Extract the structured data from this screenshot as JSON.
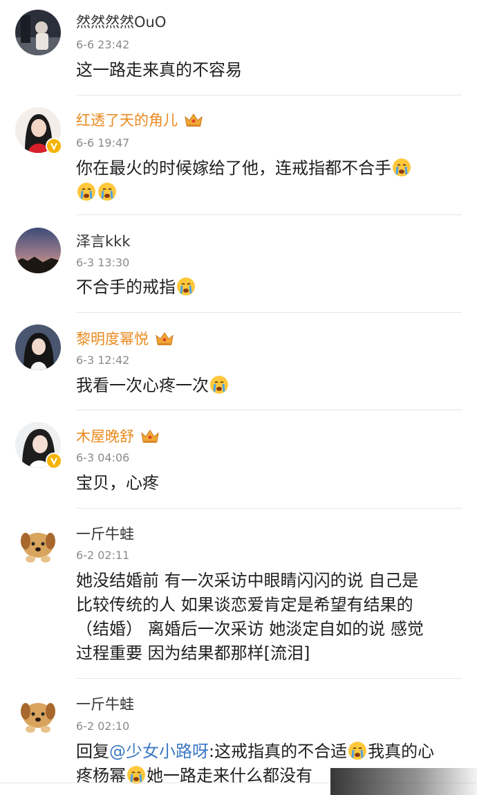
{
  "comments": [
    {
      "name": "然然然然OuO",
      "time": "6-6 23:42",
      "text": "这一路走来真的不容易"
    },
    {
      "name": "红透了天的角儿",
      "time": "6-6 19:47",
      "text_a": "你在最火的时候嫁给了他，连戒指都不合手"
    },
    {
      "name": "泽言kkk",
      "time": "6-3 13:30",
      "text_a": "不合手的戒指"
    },
    {
      "name": "黎明度幂悦",
      "time": "6-3 12:42",
      "text_a": "我看一次心疼一次"
    },
    {
      "name": "木屋晚舒",
      "time": "6-3 04:06",
      "text": "宝贝，心疼"
    },
    {
      "name": "一斤牛蛙",
      "time": "6-2 02:11",
      "lines": [
        "她没结婚前 有一次采访中眼睛闪闪的说 自己是",
        "比较传统的人 如果谈恋爱肯定是希望有结果的",
        "（结婚） 离婚后一次采访 她淡定自如的说 感觉",
        "过程重要 因为结果都那样[流泪]"
      ]
    },
    {
      "name": "一斤牛蛙",
      "time": "6-2 02:10",
      "reply_prefix": "回复",
      "mention": "@少女小路呀",
      "text_a": ":这戒指真的不合适",
      "text_b": "我真的心",
      "text_c": "疼杨幂",
      "text_d": "她一路走来什么都没有"
    }
  ],
  "colors": {
    "vip_name": "#e98a1e",
    "mention": "#3a78c2",
    "time": "#8a8a8a",
    "verified": "#f6b400"
  },
  "icons": {
    "crown": "crown-icon",
    "cry": "crying-face-icon",
    "verified": "verified-badge-icon"
  }
}
